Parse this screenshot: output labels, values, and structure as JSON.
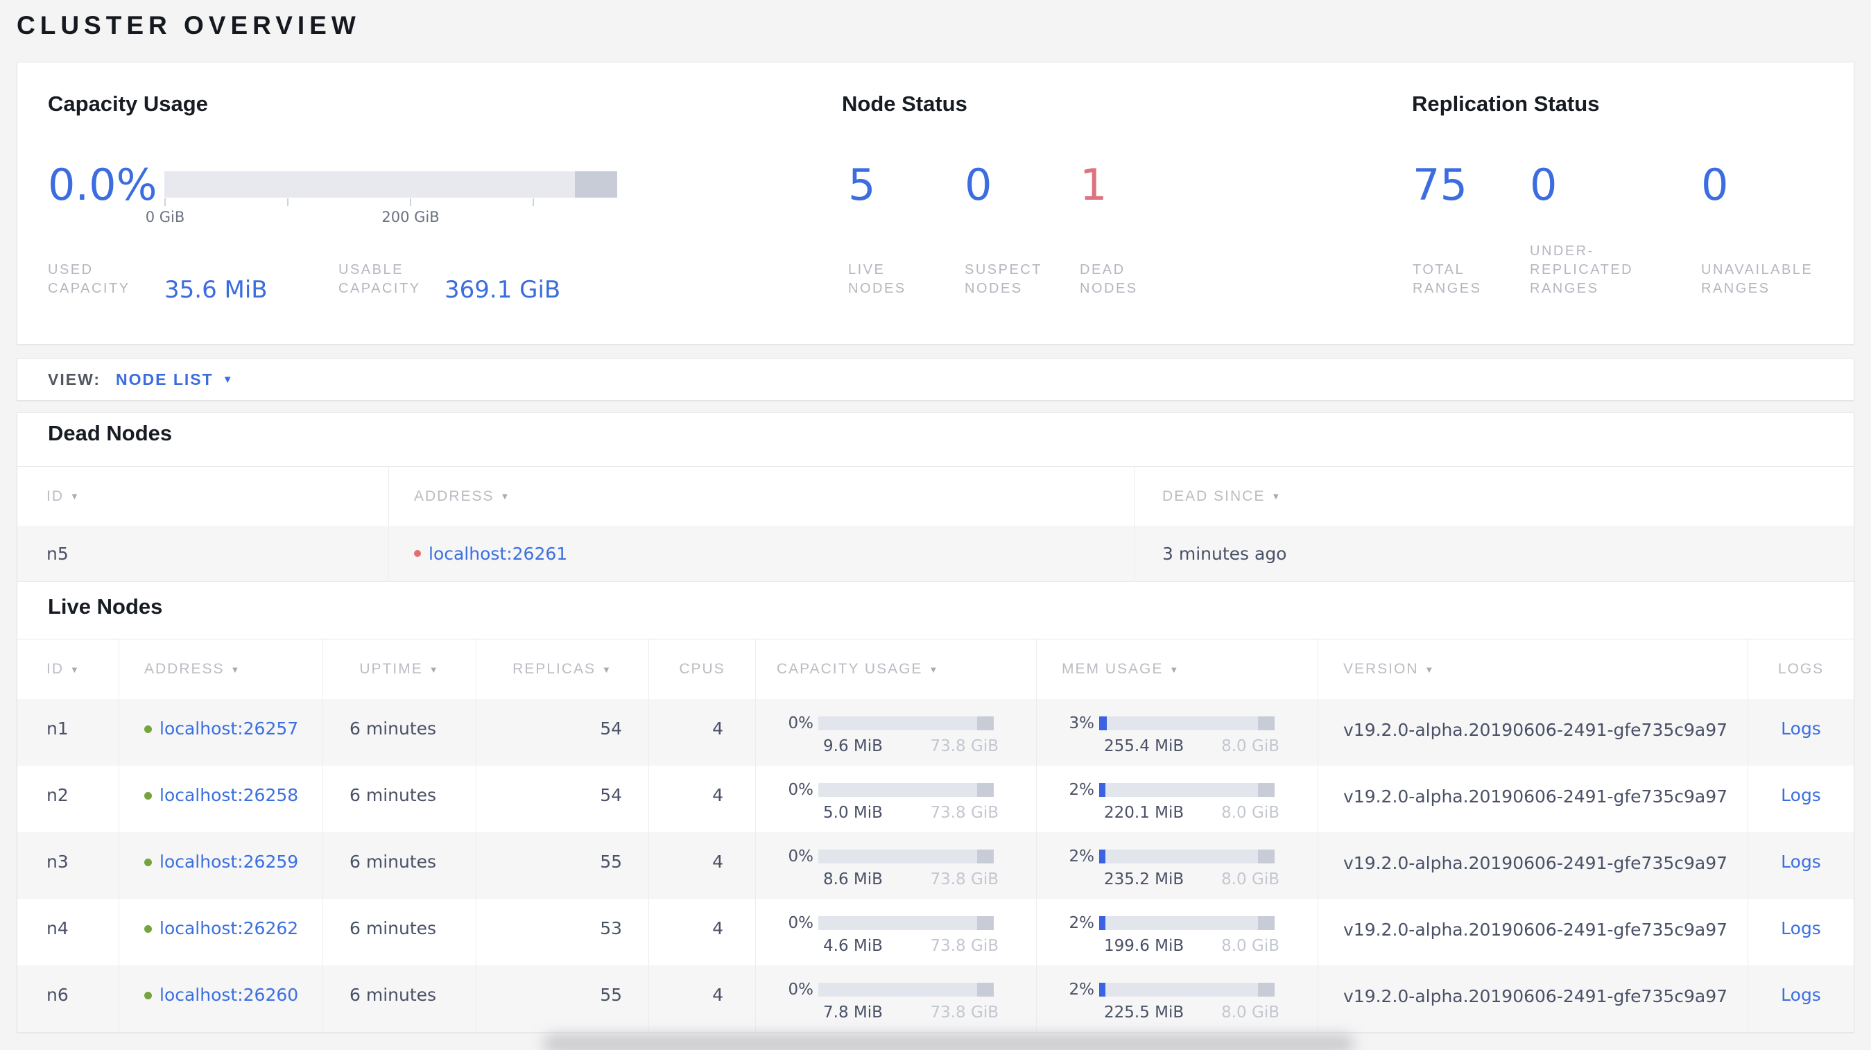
{
  "page": {
    "title": "CLUSTER OVERVIEW"
  },
  "colors": {
    "accent_blue": "#3b6ce0",
    "link_blue": "#3b6fe0",
    "dead_red": "#de727e",
    "live_green": "#74a43c",
    "bar_track": "#e2e5ec",
    "bar_other": "#c7ccd7",
    "bar_fill": "#3a62e2"
  },
  "summary": {
    "capacity": {
      "title": "Capacity Usage",
      "percent": "0.0%",
      "tick_labels": [
        "0 GiB",
        "200 GiB"
      ],
      "used_label_lines": [
        "USED",
        "CAPACITY"
      ],
      "used_value": "35.6 MiB",
      "usable_label_lines": [
        "USABLE",
        "CAPACITY"
      ],
      "usable_value": "369.1 GiB"
    },
    "node_status": {
      "title": "Node Status",
      "stats": [
        {
          "value": "5",
          "status": "live",
          "label_lines": [
            "LIVE",
            "NODES"
          ]
        },
        {
          "value": "0",
          "status": "suspect",
          "label_lines": [
            "SUSPECT",
            "NODES"
          ]
        },
        {
          "value": "1",
          "status": "dead",
          "label_lines": [
            "DEAD",
            "NODES"
          ]
        }
      ]
    },
    "replication": {
      "title": "Replication Status",
      "stats": [
        {
          "value": "75",
          "label_lines": [
            "TOTAL",
            "RANGES"
          ]
        },
        {
          "value": "0",
          "label_lines": [
            "UNDER-",
            "REPLICATED",
            "RANGES"
          ]
        },
        {
          "value": "0",
          "label_lines": [
            "UNAVAILABLE",
            "RANGES"
          ]
        }
      ]
    }
  },
  "view_bar": {
    "label": "VIEW:",
    "selected": "NODE LIST"
  },
  "dead_nodes": {
    "title": "Dead Nodes",
    "columns": [
      {
        "label": "ID",
        "sortable": true
      },
      {
        "label": "ADDRESS",
        "sortable": true
      },
      {
        "label": "DEAD SINCE",
        "sortable": true
      }
    ],
    "rows": [
      {
        "id": "n5",
        "address": "localhost:26261",
        "dead_since": "3 minutes ago"
      }
    ]
  },
  "live_nodes": {
    "title": "Live Nodes",
    "columns": [
      {
        "label": "ID",
        "sortable": true
      },
      {
        "label": "ADDRESS",
        "sortable": true
      },
      {
        "label": "UPTIME",
        "sortable": true
      },
      {
        "label": "REPLICAS",
        "sortable": true
      },
      {
        "label": "CPUS",
        "sortable": false
      },
      {
        "label": "CAPACITY USAGE",
        "sortable": true
      },
      {
        "label": "MEM USAGE",
        "sortable": true
      },
      {
        "label": "VERSION",
        "sortable": true
      },
      {
        "label": "LOGS",
        "sortable": false
      }
    ],
    "rows": [
      {
        "id": "n1",
        "address": "localhost:26257",
        "uptime": "6 minutes",
        "replicas": "54",
        "cpus": "4",
        "capacity": {
          "percent": "0%",
          "pct": 0,
          "used": "9.6 MiB",
          "total": "73.8 GiB"
        },
        "mem": {
          "percent": "3%",
          "pct": 3,
          "used": "255.4 MiB",
          "total": "8.0 GiB"
        },
        "version": "v19.2.0-alpha.20190606-2491-gfe735c9a97",
        "logs": "Logs"
      },
      {
        "id": "n2",
        "address": "localhost:26258",
        "uptime": "6 minutes",
        "replicas": "54",
        "cpus": "4",
        "capacity": {
          "percent": "0%",
          "pct": 0,
          "used": "5.0 MiB",
          "total": "73.8 GiB"
        },
        "mem": {
          "percent": "2%",
          "pct": 2,
          "used": "220.1 MiB",
          "total": "8.0 GiB"
        },
        "version": "v19.2.0-alpha.20190606-2491-gfe735c9a97",
        "logs": "Logs"
      },
      {
        "id": "n3",
        "address": "localhost:26259",
        "uptime": "6 minutes",
        "replicas": "55",
        "cpus": "4",
        "capacity": {
          "percent": "0%",
          "pct": 0,
          "used": "8.6 MiB",
          "total": "73.8 GiB"
        },
        "mem": {
          "percent": "2%",
          "pct": 2,
          "used": "235.2 MiB",
          "total": "8.0 GiB"
        },
        "version": "v19.2.0-alpha.20190606-2491-gfe735c9a97",
        "logs": "Logs"
      },
      {
        "id": "n4",
        "address": "localhost:26262",
        "uptime": "6 minutes",
        "replicas": "53",
        "cpus": "4",
        "capacity": {
          "percent": "0%",
          "pct": 0,
          "used": "4.6 MiB",
          "total": "73.8 GiB"
        },
        "mem": {
          "percent": "2%",
          "pct": 2,
          "used": "199.6 MiB",
          "total": "8.0 GiB"
        },
        "version": "v19.2.0-alpha.20190606-2491-gfe735c9a97",
        "logs": "Logs"
      },
      {
        "id": "n6",
        "address": "localhost:26260",
        "uptime": "6 minutes",
        "replicas": "55",
        "cpus": "4",
        "capacity": {
          "percent": "0%",
          "pct": 0,
          "used": "7.8 MiB",
          "total": "73.8 GiB"
        },
        "mem": {
          "percent": "2%",
          "pct": 2,
          "used": "225.5 MiB",
          "total": "8.0 GiB"
        },
        "version": "v19.2.0-alpha.20190606-2491-gfe735c9a97",
        "logs": "Logs"
      }
    ]
  }
}
